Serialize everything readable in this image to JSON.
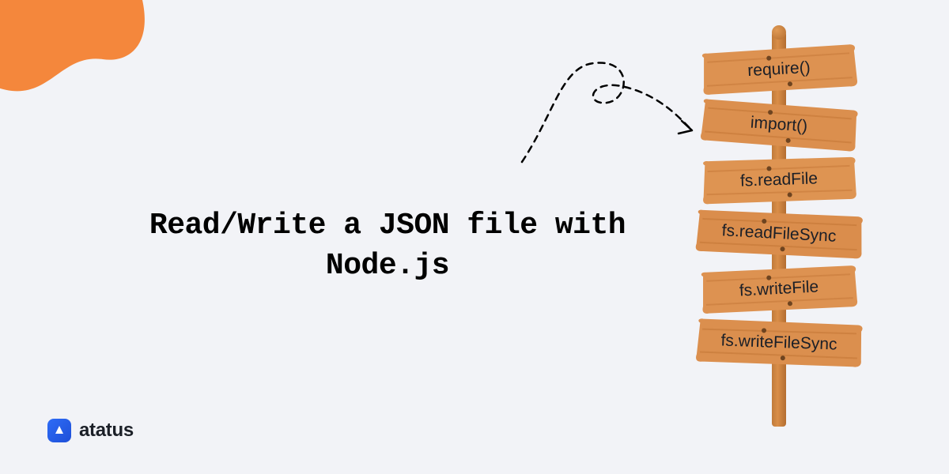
{
  "headline": "Read/Write a JSON file with Node.js",
  "brand": {
    "name": "atatus"
  },
  "signs": {
    "items": [
      {
        "label": "require()"
      },
      {
        "label": "import()"
      },
      {
        "label": "fs.readFile"
      },
      {
        "label": "fs.readFileSync"
      },
      {
        "label": "fs.writeFile"
      },
      {
        "label": "fs.writeFileSync"
      }
    ]
  },
  "colors": {
    "background": "#f2f3f7",
    "accent": "#f4873c",
    "brand": "#2e6cf6",
    "wood_light": "#dd9251",
    "wood_dark": "#c07636"
  }
}
